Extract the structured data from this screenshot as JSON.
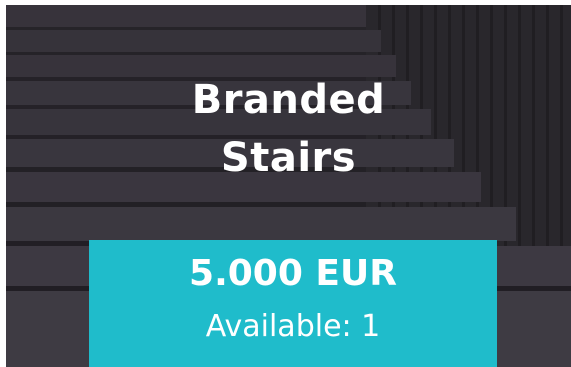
{
  "product": {
    "title_line1": "Branded",
    "title_line2": "Stairs",
    "price": "5.000 EUR",
    "available_label": "Available:",
    "available_value": "1"
  },
  "colors": {
    "price_box": "#1fbccb",
    "background": "#3a3740",
    "text": "#ffffff"
  }
}
